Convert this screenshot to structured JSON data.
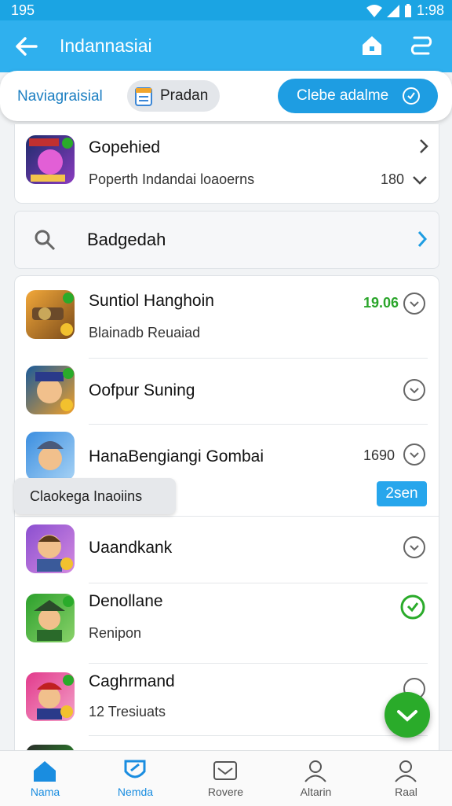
{
  "status_bar": {
    "time_left": "195",
    "time_right": "1:98"
  },
  "app_bar": {
    "title": "Indannasiai",
    "back_icon": "arrow-left-icon",
    "home_icon": "home-icon",
    "swap_icon": "swap-icon"
  },
  "filter_bar": {
    "label": "Naviagraisial",
    "chip_label": "Pradan",
    "cta_label": "Clebe adalme"
  },
  "top_card": {
    "title": "Gopehied",
    "subtitle": "Poperth Indandai loaoerns",
    "count": "180"
  },
  "search": {
    "label": "Badgedah"
  },
  "list_items": [
    {
      "title": "Suntiol Hanghoin",
      "subtitle": "Blainadb Reuaiad",
      "value": "19.06",
      "value_color": "#2aa52a"
    },
    {
      "title": "Oofpur Suning",
      "subtitle": "",
      "value": ""
    },
    {
      "title": "HanaBengiangi Gombai",
      "subtitle": "",
      "value": "1690"
    },
    {
      "title": "Uaandkank",
      "subtitle": "",
      "value": ""
    },
    {
      "title": "Denollane",
      "subtitle": "Renipon",
      "value": ""
    },
    {
      "title": "Caghrmand",
      "subtitle": "12 Tresiuats",
      "value": ""
    }
  ],
  "tooltip": {
    "label": "Claokega Inaoiins"
  },
  "badge": {
    "label": "2sen"
  },
  "bottom_nav": [
    {
      "label": "Nama"
    },
    {
      "label": "Nemda"
    },
    {
      "label": "Rovere"
    },
    {
      "label": "Altarin"
    },
    {
      "label": "Raal"
    }
  ],
  "colors": {
    "primary": "#2fb0ee",
    "accent": "#1e9de2",
    "success": "#2aab2a"
  }
}
